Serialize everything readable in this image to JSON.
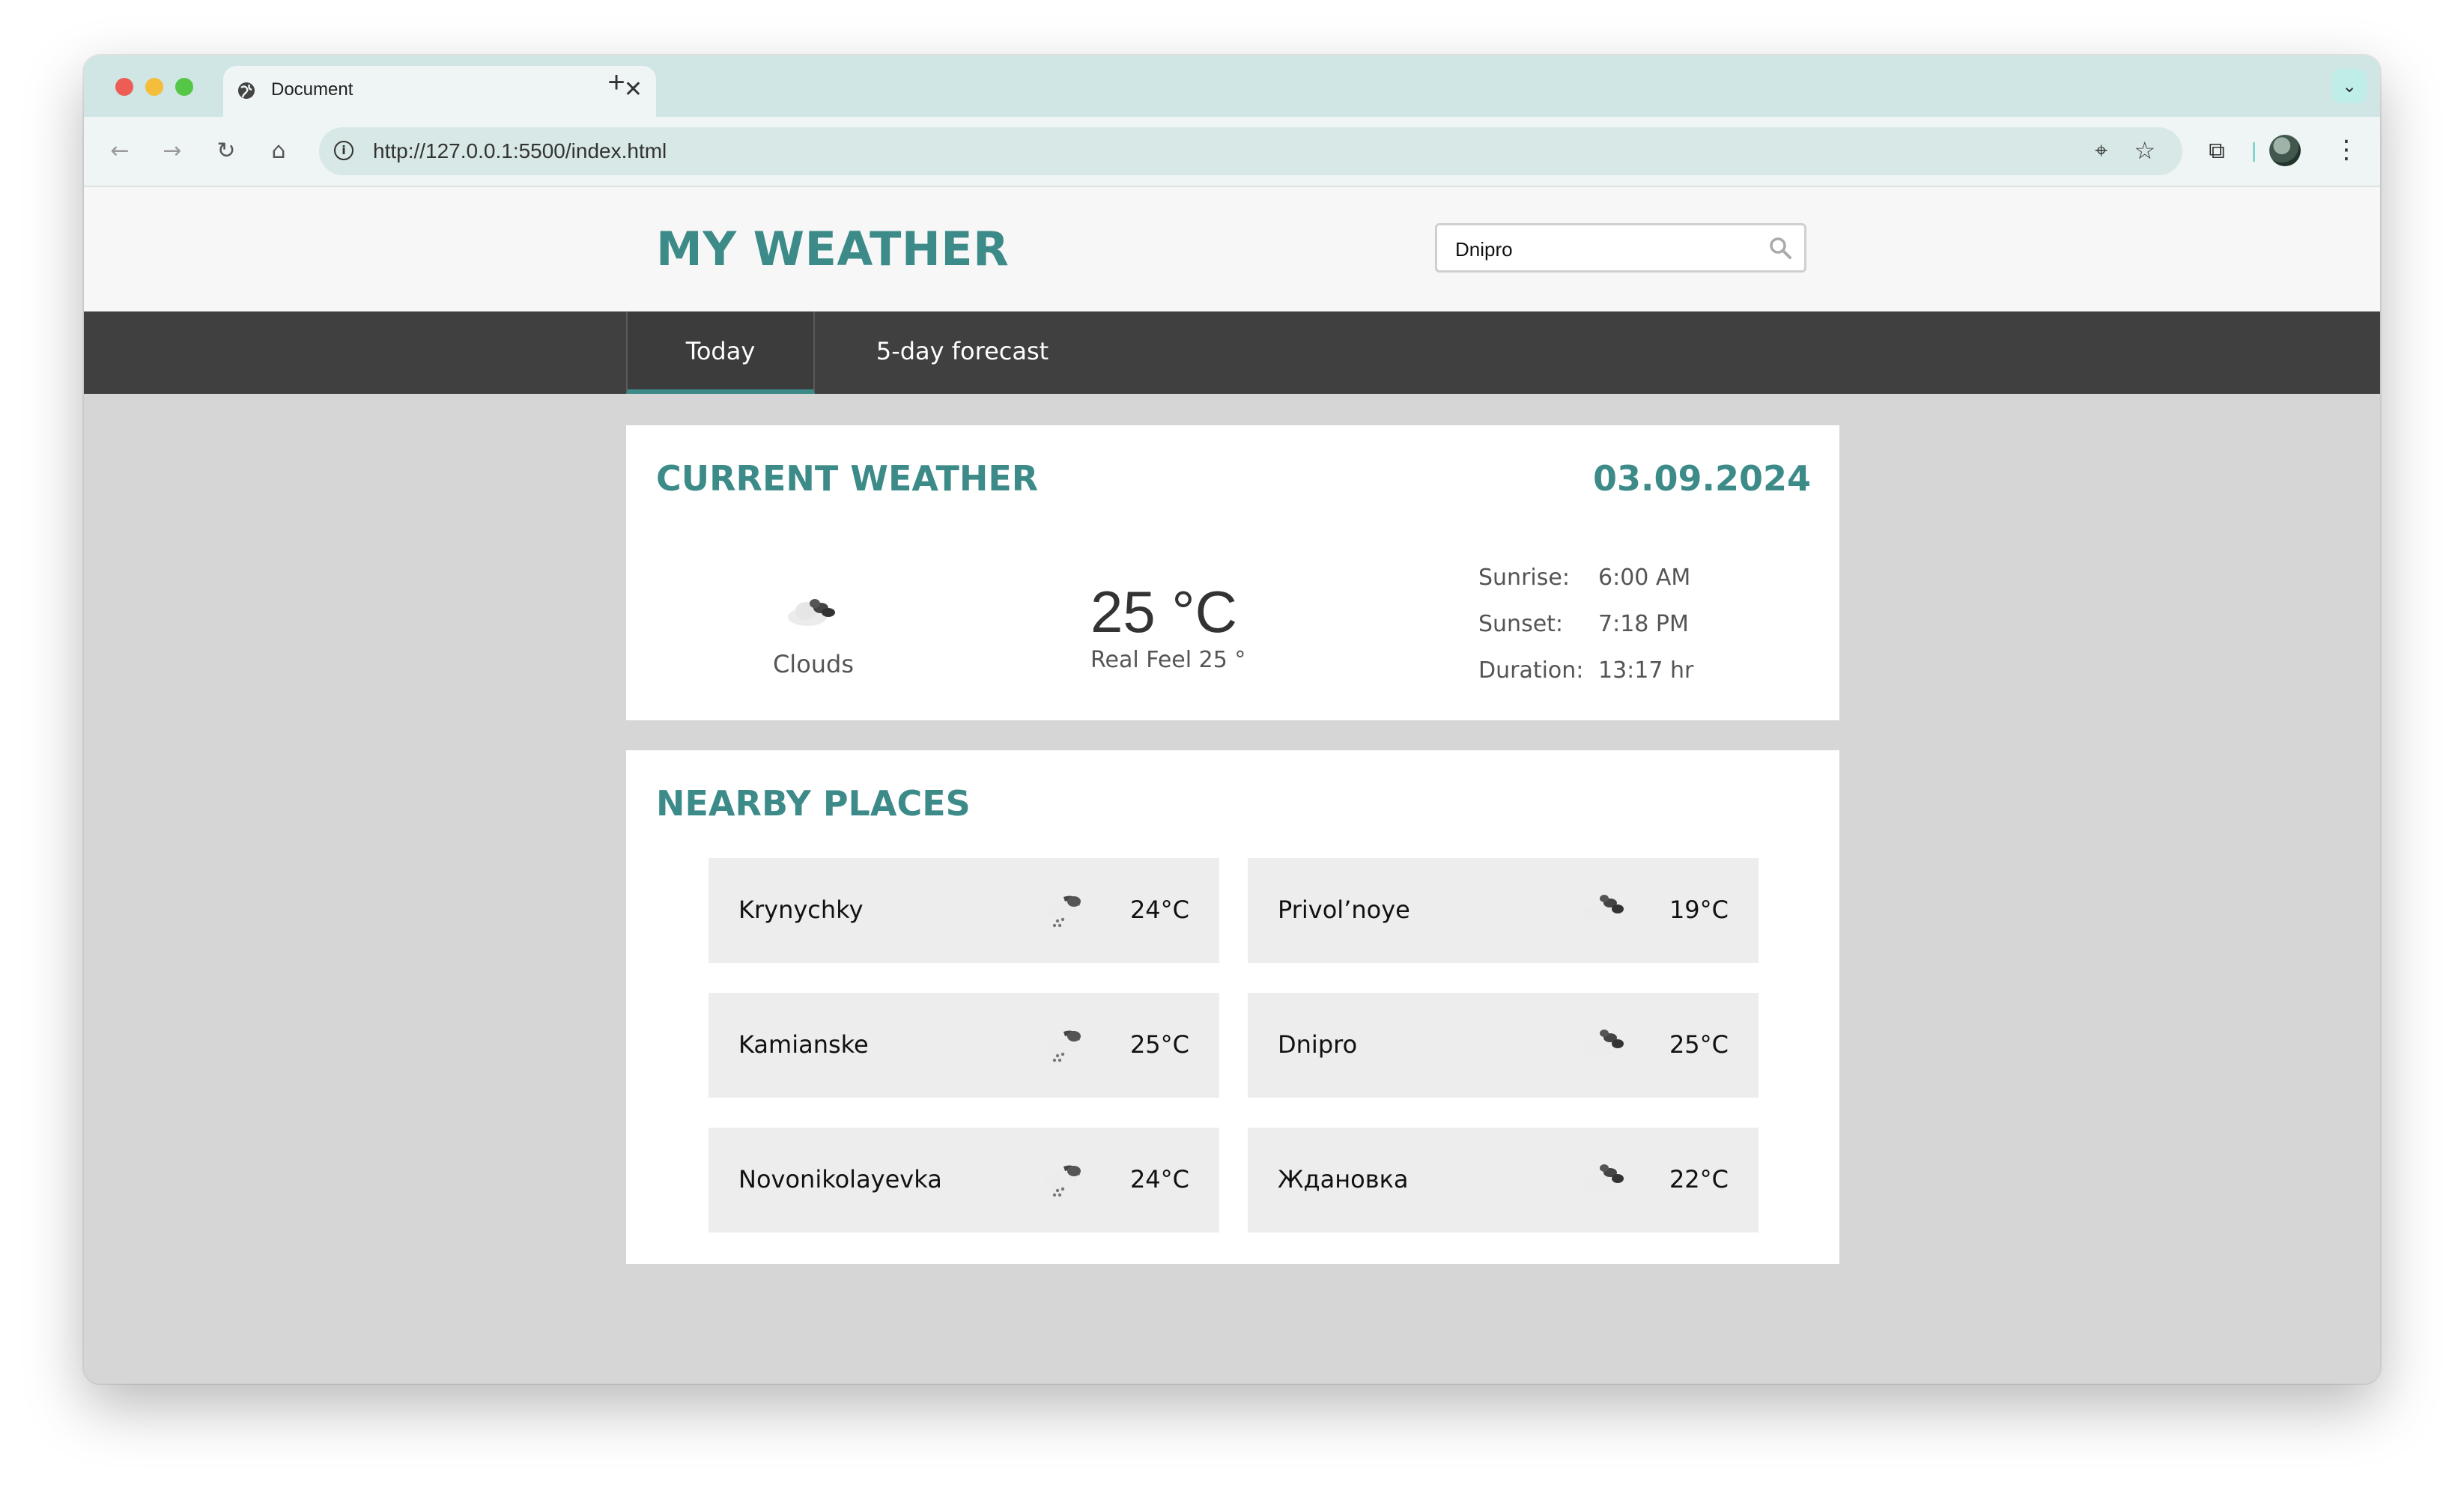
{
  "browser": {
    "tab_title": "Document",
    "url": "http://127.0.0.1:5500/index.html"
  },
  "site": {
    "logo": "MY WEATHER",
    "search_value": "Dnipro",
    "nav": [
      "Today",
      "5-day forecast"
    ]
  },
  "current": {
    "title": "CURRENT WEATHER",
    "date": "03.09.2024",
    "condition": "Clouds",
    "condition_icon": "clouds-icon",
    "temperature": "25 °C",
    "real_feel": "Real Feel 25 °",
    "sunrise_label": "Sunrise:",
    "sunrise": "6:00 AM",
    "sunset_label": "Sunset:",
    "sunset": "7:18 PM",
    "duration_label": "Duration:",
    "duration": "13:17 hr"
  },
  "nearby": {
    "title": "NEARBY PLACES",
    "places": [
      {
        "name": "Krynychky",
        "icon": "rain-icon",
        "temp": "24°C"
      },
      {
        "name": "Privol’noye",
        "icon": "clouds-icon",
        "temp": "19°C"
      },
      {
        "name": "Kamianske",
        "icon": "rain-icon",
        "temp": "25°C"
      },
      {
        "name": "Dnipro",
        "icon": "clouds-icon",
        "temp": "25°C"
      },
      {
        "name": "Novonikolayevka",
        "icon": "rain-icon",
        "temp": "24°C"
      },
      {
        "name": "Ждановка",
        "icon": "clouds-icon",
        "temp": "22°C"
      }
    ]
  },
  "colors": {
    "accent": "#3c8b89",
    "navbar": "#404040",
    "page_bg": "#d6d6d6"
  }
}
